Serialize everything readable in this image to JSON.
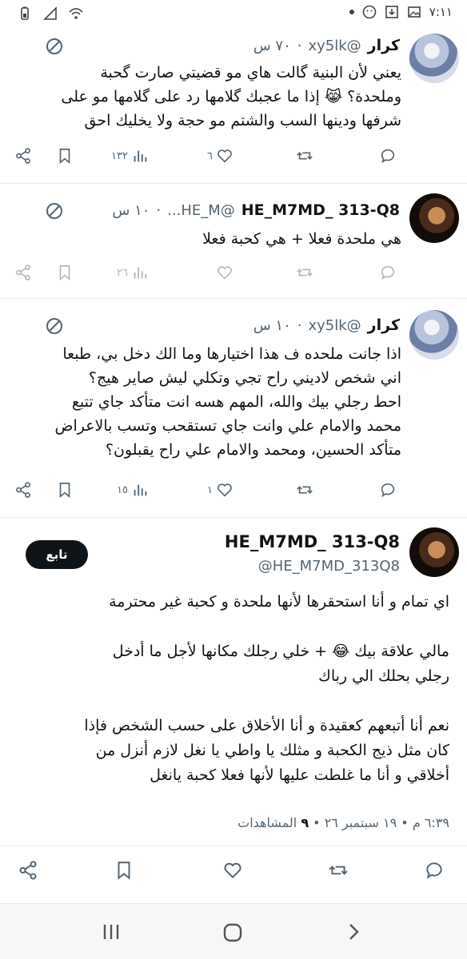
{
  "status": {
    "time": "٧:١١"
  },
  "tweets": [
    {
      "name": "كرار",
      "handle": "@xy5lk",
      "time": "٧٠ س",
      "text_lines": [
        "يعني لأن البنية گالت هاي مو قضيتي صارت گحبة",
        "وملحدة؟ 😹 إذا ما عجبك گلامها رد على گلامها مو على",
        "شرفها ودينها السب والشتم مو حجة ولا يخليك احق"
      ],
      "reply_count": "",
      "retweet_count": "",
      "like_count": "٦",
      "views": "١٣٢"
    },
    {
      "name": "HE_M7MD_ 313-Q8",
      "handle": "@HE_M...",
      "time": "١٠ س",
      "text_lines": [
        "هي ملحدة فعلا + هي كحبة فعلا"
      ],
      "reply_count": "",
      "retweet_count": "",
      "like_count": "",
      "views": "٢٦"
    },
    {
      "name": "كرار",
      "handle": "@xy5lk",
      "time": "١٠ س",
      "text_lines": [
        "اذا جانت ملحده  ف هذا اختيارها وما الك دخل بي، طبعا",
        "اني شخص لاديني راح تجي وتكلي ليش صاير هيج؟",
        "احط رجلي بيك والله، المهم هسه انت متأكد جاي تتبع",
        "محمد والامام علي وانت جاي تستقحب وتسب بالاعراض",
        "متأكد الحسين، ومحمد والامام علي راح يقبلون؟"
      ],
      "reply_count": "",
      "retweet_count": "",
      "like_count": "١",
      "views": "١٥"
    }
  ],
  "main_tweet": {
    "name": "HE_M7MD_ 313-Q8",
    "handle": "@HE_M7MD_313Q8",
    "follow_label": "تابع",
    "paragraphs": [
      [
        "اي تمام و أنا استحقرها لأنها ملحدة و كحبة غير محترمة"
      ],
      [
        "مالي علاقة بيك 😂 + خلي رجلك مكانها لأجل ما أدخل",
        "رجلي بحلك الي رباك"
      ],
      [
        "نعم أنا أتبعهم كعقيدة و أنا الأخلاق على حسب الشخص فإذا",
        "كان مثل ذيج الكحبة و مثلك يا واطي يا نغل لازم أنزل من",
        "أخلاقي و أنا ما غلطت عليها لأنها فعلا كحبة يانغل"
      ]
    ],
    "timestamp": "٦:٣٩ م • ١٩ سبتمبر ٢٦ •",
    "views_count": "٩",
    "views_label": "المشاهدات"
  }
}
